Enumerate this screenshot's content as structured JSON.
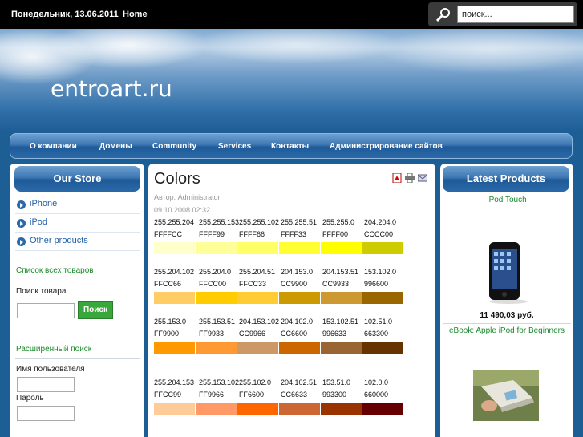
{
  "topbar": {
    "date": "Понедельник, 13.06.2011",
    "home": "Home",
    "search_placeholder": "поиск..."
  },
  "header": {
    "site_title": "entroart.ru"
  },
  "nav": {
    "items": [
      "О компании",
      "Домены",
      "Community",
      "Services",
      "Контакты",
      "Администрирование сайтов"
    ]
  },
  "left": {
    "store_title": "Our Store",
    "menu": [
      "iPhone",
      "iPod",
      "Other products"
    ],
    "all_products": "Список всех товаров",
    "product_search_label": "Поиск товара",
    "search_button": "Поиск",
    "advanced_search": "Расширенный поиск",
    "username_label": "Имя пользователя",
    "password_label": "Пароль"
  },
  "main": {
    "title": "Colors",
    "author": "Автор: Administrator",
    "date": "09.10.2008 02:32",
    "rows": [
      {
        "rgb": [
          "255.255.204",
          "255.255.153",
          "255.255.102",
          "255.255.51",
          "255.255.0",
          "204.204.0"
        ],
        "hex": [
          "FFFFCC",
          "FFFF99",
          "FFFF66",
          "FFFF33",
          "FFFF00",
          "CCCC00"
        ]
      },
      {
        "rgb": [
          "255.204.102",
          "255.204.0",
          "255.204.51",
          "204.153.0",
          "204.153.51",
          "153.102.0"
        ],
        "hex": [
          "FFCC66",
          "FFCC00",
          "FFCC33",
          "CC9900",
          "CC9933",
          "996600"
        ]
      },
      {
        "rgb": [
          "255.153.0",
          "255.153.51",
          "204.153.102",
          "204.102.0",
          "153.102.51",
          "102.51.0"
        ],
        "hex": [
          "FF9900",
          "FF9933",
          "CC9966",
          "CC6600",
          "996633",
          "663300"
        ]
      },
      {
        "rgb": [
          "255.204.153",
          "255.153.102",
          "255.102.0",
          "204.102.51",
          "153.51.0",
          "102.0.0"
        ],
        "hex": [
          "FFCC99",
          "FF9966",
          "FF6600",
          "CC6633",
          "993300",
          "660000"
        ]
      }
    ]
  },
  "right": {
    "title": "Latest Products",
    "product1_name": "iPod Touch",
    "product1_price": "11 490,03 руб.",
    "product2_name": "eBook: Apple iPod for Beginners"
  },
  "colors": {
    "nav_blue": "#2a69a8",
    "link_green": "#1a8a2a",
    "link_blue": "#1f5fa8",
    "button_green": "#38a83a"
  },
  "icons": [
    "search-icon",
    "pdf-icon",
    "print-icon",
    "email-icon",
    "menu-bullet-icon"
  ]
}
